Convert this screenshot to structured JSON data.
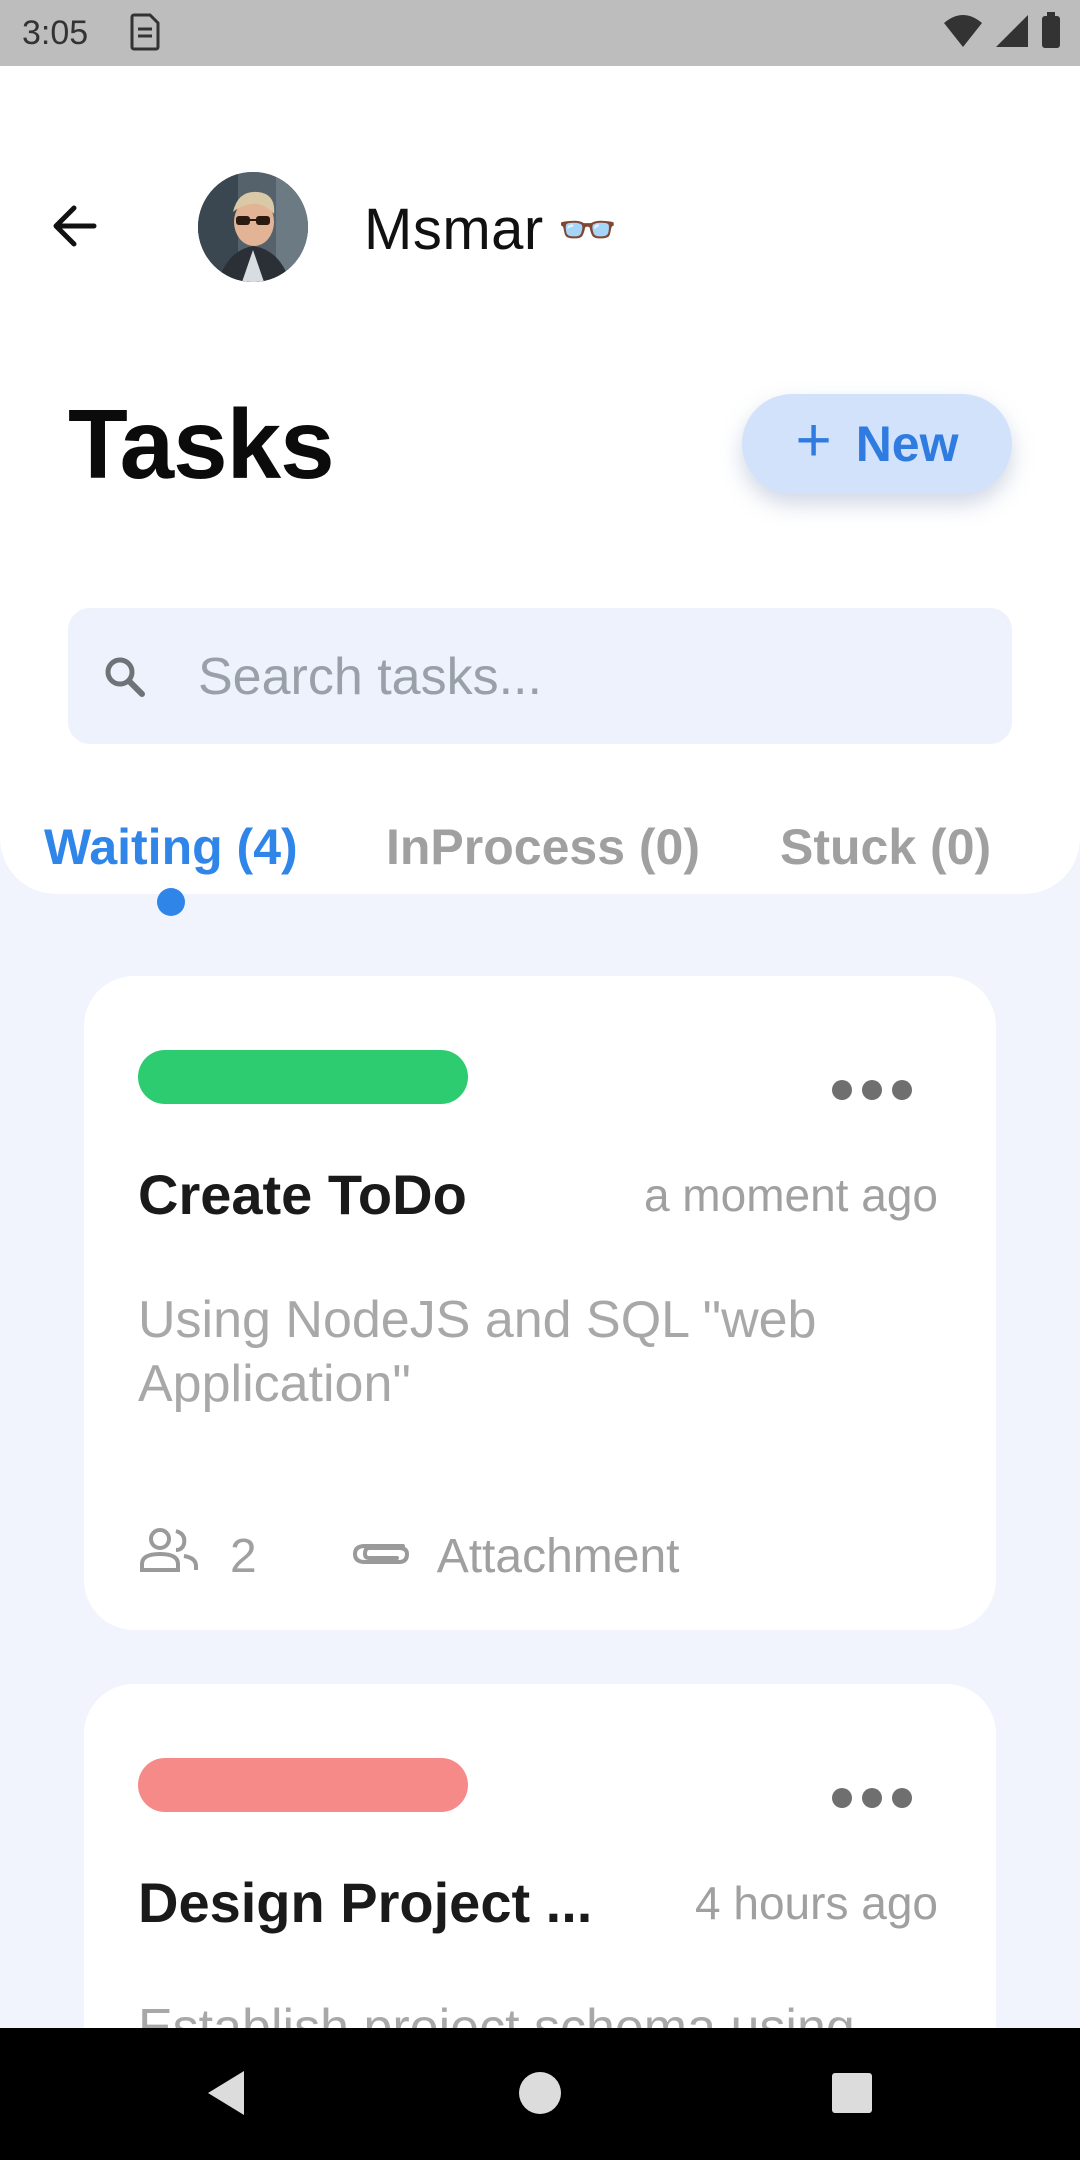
{
  "status_bar": {
    "time": "3:05"
  },
  "header": {
    "username": "Msmar",
    "username_emoji": "👓",
    "page_title": "Tasks",
    "new_button_label": "New"
  },
  "search": {
    "placeholder": "Search tasks..."
  },
  "tabs": [
    {
      "label": "Waiting (4)",
      "active": true
    },
    {
      "label": "InProcess (0)",
      "active": false
    },
    {
      "label": "Stuck (0)",
      "active": false
    }
  ],
  "cards": [
    {
      "tag_color": "#2ecc71",
      "title": "Create ToDo",
      "time": "a moment ago",
      "description": "Using NodeJS and SQL \"web Application\"",
      "members": "2",
      "attachment_label": "Attachment"
    },
    {
      "tag_color": "#f58a88",
      "title": "Design Project ...",
      "time": "4 hours ago",
      "description": "Establish project schema using"
    }
  ],
  "colors": {
    "accent": "#2f86e8",
    "background": "#f1f4fd"
  },
  "icons": {
    "back": "arrow-left-icon",
    "search": "search-icon",
    "more": "more-horizontal-icon",
    "members": "people-icon",
    "attachment": "paperclip-icon"
  }
}
